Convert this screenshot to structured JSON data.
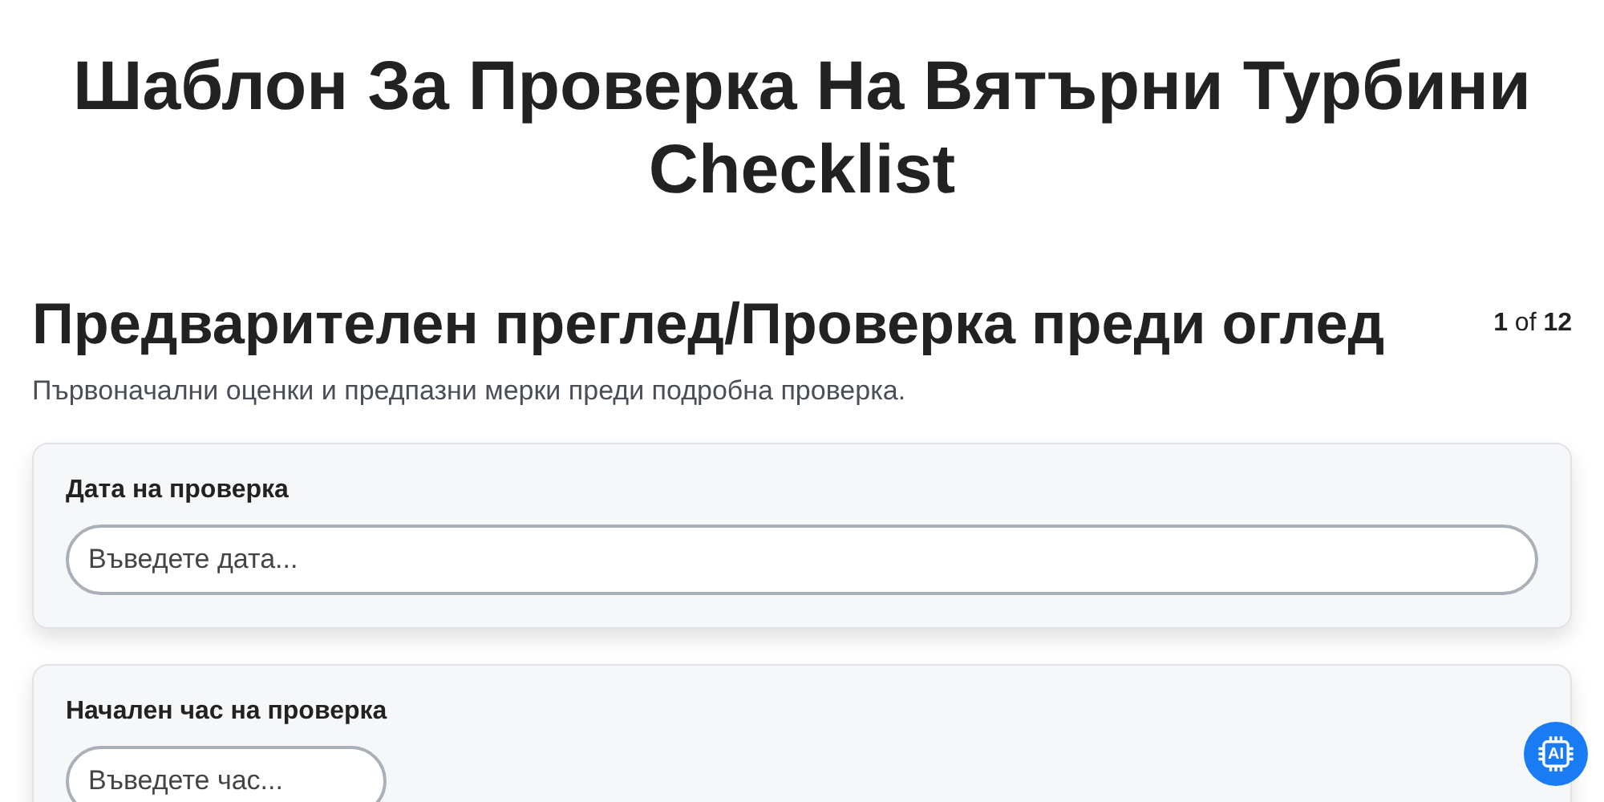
{
  "title": "Шаблон За Проверка На Вятърни Турбини Checklist",
  "section": {
    "heading": "Предварителен преглед/Проверка преди оглед",
    "page_counter": "**1** of **12**",
    "description": "Първоначални оценки и предпазни мерки преди подробна проверка."
  },
  "fields": [
    {
      "label": "Дата на проверка",
      "placeholder": "Въведете дата...",
      "kind": "wide"
    },
    {
      "label": "Начален час на проверка",
      "placeholder": "Въведете час...",
      "kind": "short"
    }
  ],
  "ai_button": {
    "label": "AI"
  }
}
